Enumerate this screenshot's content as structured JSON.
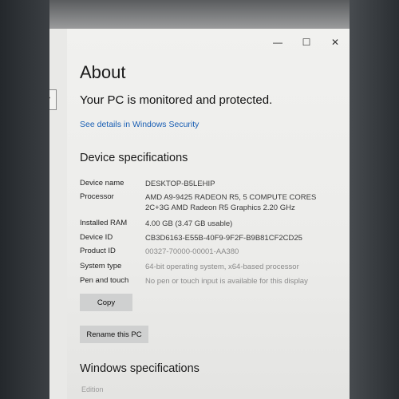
{
  "window": {
    "minimize_glyph": "—",
    "maximize_glyph": "☐",
    "close_glyph": "✕"
  },
  "behind": {
    "glyph": "›"
  },
  "about": {
    "title": "About",
    "status": "Your PC is monitored and protected.",
    "security_link": "See details in Windows Security"
  },
  "device_specs": {
    "heading": "Device specifications",
    "rows": [
      {
        "label": "Device name",
        "value": "DESKTOP-B5LEHIP"
      },
      {
        "label": "Processor",
        "value": "AMD A9-9425 RADEON R5, 5 COMPUTE CORES 2C+3G   AMD Radeon R5 Graphics 2.20 GHz"
      },
      {
        "label": "Installed RAM",
        "value": "4.00 GB (3.47 GB usable)"
      },
      {
        "label": "Device ID",
        "value": "CB3D6163-E55B-40F9-9F2F-B9B81CF2CD25"
      },
      {
        "label": "Product ID",
        "value": "00327-70000-00001-AA380"
      },
      {
        "label": "System type",
        "value": "64-bit operating system, x64-based processor"
      },
      {
        "label": "Pen and touch",
        "value": "No pen or touch input is available for this display"
      }
    ],
    "copy_button": "Copy",
    "rename_button": "Rename this PC"
  },
  "windows_specs": {
    "heading": "Windows specifications",
    "edition_label": "Edition"
  }
}
